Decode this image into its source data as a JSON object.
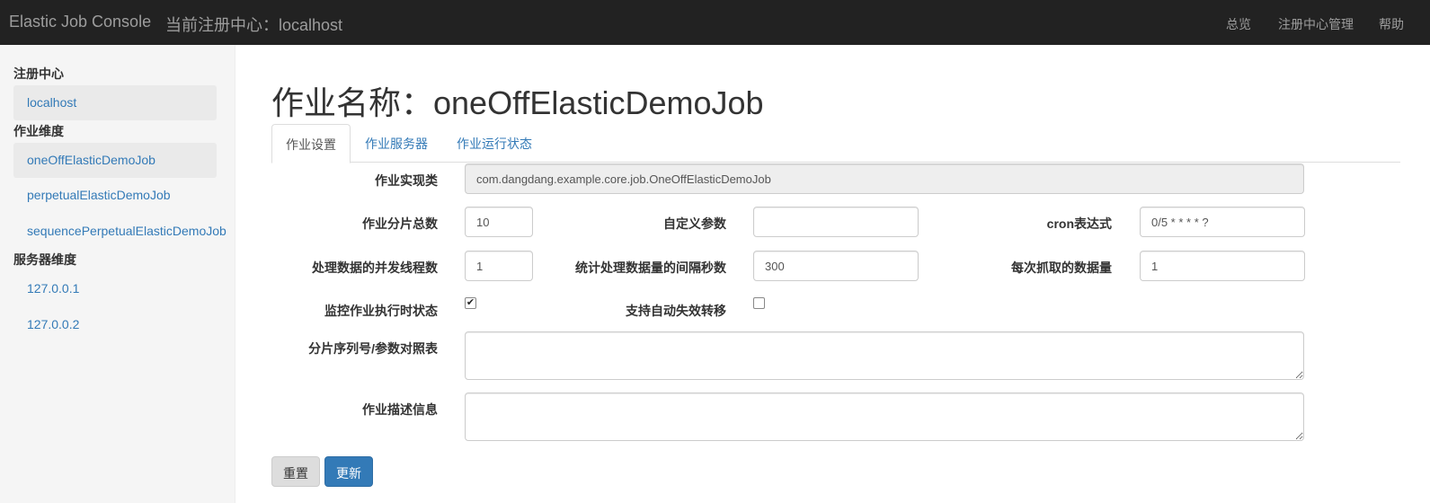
{
  "navbar": {
    "brand": "Elastic Job Console",
    "registry": "当前注册中心：localhost",
    "links": [
      "总览",
      "注册中心管理",
      "帮助"
    ]
  },
  "sidebar": {
    "registry_title": "注册中心",
    "registry_items": [
      "localhost"
    ],
    "job_title": "作业维度",
    "job_items": [
      "oneOffElasticDemoJob",
      "perpetualElasticDemoJob",
      "sequencePerpetualElasticDemoJob"
    ],
    "server_title": "服务器维度",
    "server_items": [
      "127.0.0.1",
      "127.0.0.2"
    ]
  },
  "page": {
    "title": "作业名称：oneOffElasticDemoJob"
  },
  "tabs": [
    "作业设置",
    "作业服务器",
    "作业运行状态"
  ],
  "form": {
    "job_class_label": "作业实现类",
    "job_class_value": "com.dangdang.example.core.job.OneOffElasticDemoJob",
    "sharding_total_label": "作业分片总数",
    "sharding_total_value": "10",
    "custom_param_label": "自定义参数",
    "custom_param_value": "",
    "cron_label": "cron表达式",
    "cron_value": "0/5 * * * * ?",
    "concurrent_label": "处理数据的并发线程数",
    "concurrent_value": "1",
    "interval_label": "统计处理数据量的间隔秒数",
    "interval_value": "300",
    "fetch_label": "每次抓取的数据量",
    "fetch_value": "1",
    "monitor_label": "监控作业执行时状态",
    "monitor_checked": true,
    "failover_label": "支持自动失效转移",
    "failover_checked": false,
    "sharding_params_label": "分片序列号/参数对照表",
    "sharding_params_value": "",
    "description_label": "作业描述信息",
    "description_value": ""
  },
  "buttons": {
    "reset": "重置",
    "update": "更新"
  },
  "colors": {
    "navbar_bg": "#222222",
    "link": "#337ab7",
    "primary": "#337ab7"
  }
}
